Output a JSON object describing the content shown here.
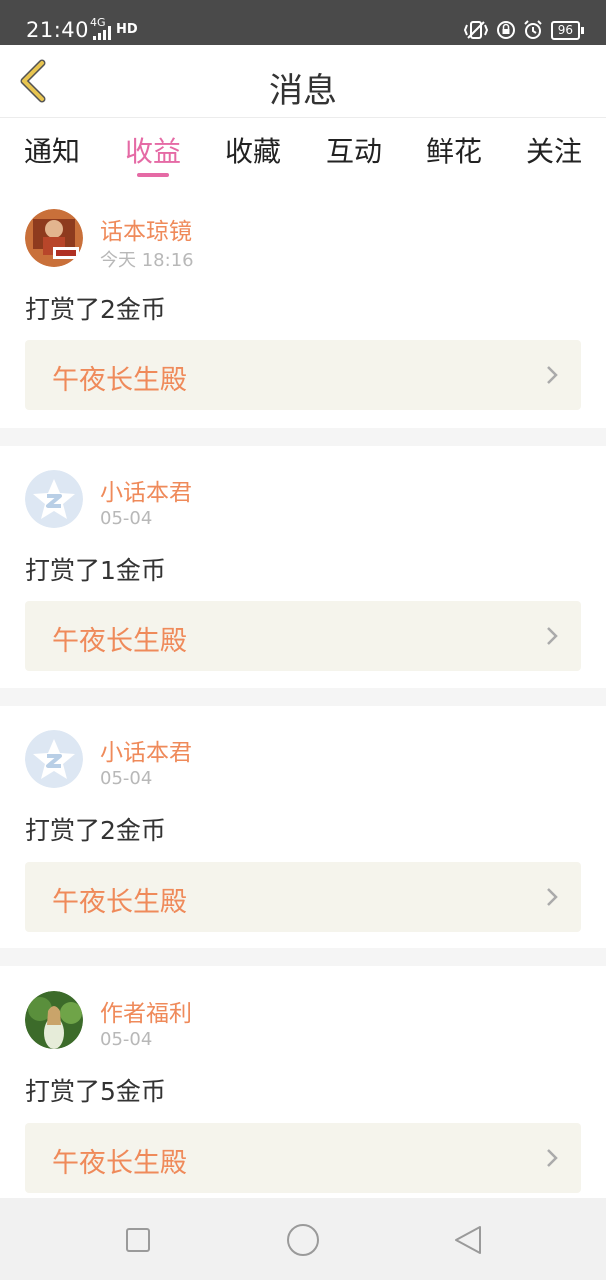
{
  "status_bar": {
    "time": "21:40",
    "network": "4G",
    "hd": "HD",
    "battery": "96"
  },
  "header": {
    "title": "消息"
  },
  "tabs": [
    {
      "label": "通知",
      "active": false
    },
    {
      "label": "收益",
      "active": true
    },
    {
      "label": "收藏",
      "active": false
    },
    {
      "label": "互动",
      "active": false
    },
    {
      "label": "鲜花",
      "active": false
    },
    {
      "label": "关注",
      "active": false
    }
  ],
  "messages": [
    {
      "name": "话本琼镜",
      "time": "今天 18:16",
      "text": "打赏了2金币",
      "book": "午夜长生殿",
      "avatar": "photo-avatar"
    },
    {
      "name": "小话本君",
      "time": "05-04",
      "text": "打赏了1金币",
      "book": "午夜长生殿",
      "avatar": "default-star-avatar"
    },
    {
      "name": "小话本君",
      "time": "05-04",
      "text": "打赏了2金币",
      "book": "午夜长生殿",
      "avatar": "default-star-avatar"
    },
    {
      "name": "作者福利",
      "time": "05-04",
      "text": "打赏了5金币",
      "book": "午夜长生殿",
      "avatar": "photo-avatar"
    }
  ],
  "colors": {
    "accent_pink": "#e56aa5",
    "accent_orange": "#ef8a5a",
    "book_box_bg": "#f5f4ec",
    "separator": "#f5f5f5",
    "back_icon": "#e8c550"
  },
  "icons": {
    "back": "chevron-left-icon",
    "chevron": "chevron-right-icon",
    "nav_recent": "square-icon",
    "nav_home": "circle-icon",
    "nav_back": "triangle-back-icon"
  }
}
